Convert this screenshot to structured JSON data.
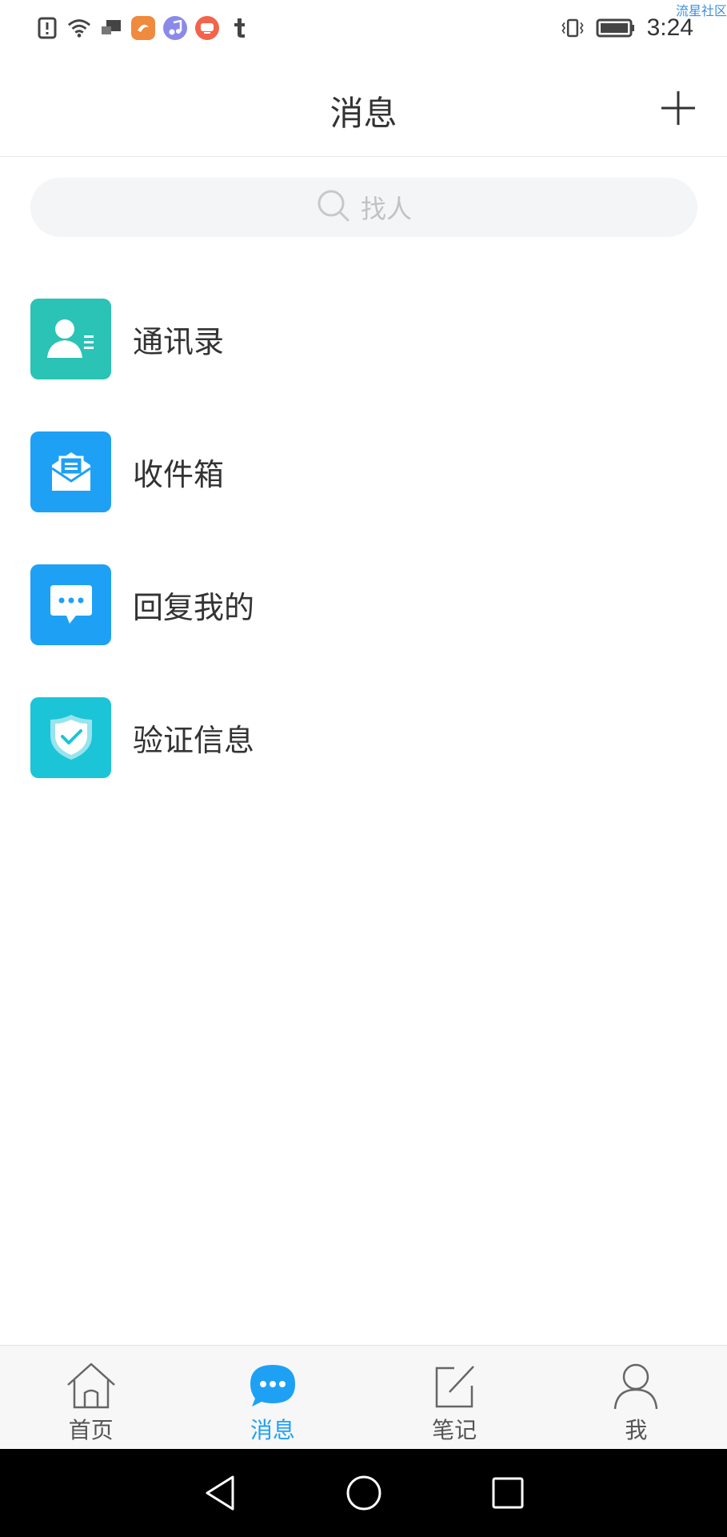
{
  "status_bar": {
    "time": "3:24",
    "watermark": "流星社区",
    "notification_icons": [
      "alert-icon",
      "wifi-icon",
      "screen-cast-icon",
      "uc-browser-icon",
      "music-icon",
      "app-icon",
      "tumblr-icon"
    ],
    "status_icons": [
      "vibrate-icon",
      "battery-icon"
    ]
  },
  "header": {
    "title": "消息",
    "action_icon": "plus-icon"
  },
  "search": {
    "placeholder": "找人"
  },
  "menu_items": [
    {
      "label": "通讯录",
      "icon": "contacts-icon",
      "color": "#2ac3b5"
    },
    {
      "label": "收件箱",
      "icon": "inbox-icon",
      "color": "#1ea1f5"
    },
    {
      "label": "回复我的",
      "icon": "reply-bubble-icon",
      "color": "#1ea1f5"
    },
    {
      "label": "验证信息",
      "icon": "shield-check-icon",
      "color": "#1cc4d8"
    }
  ],
  "tabs": [
    {
      "label": "首页",
      "icon": "home-icon",
      "active": false
    },
    {
      "label": "消息",
      "icon": "message-icon",
      "active": true
    },
    {
      "label": "笔记",
      "icon": "note-icon",
      "active": false
    },
    {
      "label": "我",
      "icon": "profile-icon",
      "active": false
    }
  ],
  "colors": {
    "accent": "#1ea1f5",
    "text": "#333333",
    "search_bg": "#f4f5f7"
  }
}
